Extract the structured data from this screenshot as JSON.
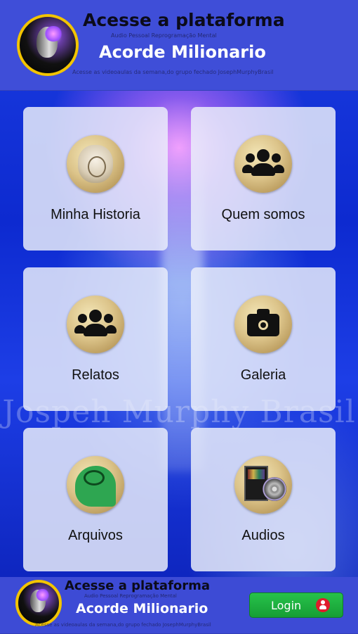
{
  "top_banner": {
    "title": "Acesse a plataforma",
    "subtitle": "Audio Pessoal Reprogramação Mental",
    "main": "Acorde Milionario",
    "footer": "Acesse as videoaulas da semana,do grupo fechado JosephMurphyBrasil"
  },
  "watermark": "Jospeh Murphy Brasil",
  "tiles": [
    {
      "label": "Minha Historia",
      "icon": "portrait-icon"
    },
    {
      "label": "Quem somos",
      "icon": "group-icon"
    },
    {
      "label": "Relatos",
      "icon": "group-icon"
    },
    {
      "label": "Galeria",
      "icon": "camera-icon"
    },
    {
      "label": "Arquivos",
      "icon": "brain-head-icon"
    },
    {
      "label": "Audios",
      "icon": "audio-cd-icon"
    }
  ],
  "bottom_banner": {
    "title": "Acesse a plataforma",
    "subtitle": "Audio Pessoal Reprogramação Mental",
    "main": "Acorde Milionario",
    "footer": "Acesse as videoaulas da semana,do grupo fechado JosephMurphyBrasil",
    "login_label": "Login",
    "login_color": "#1fb13f",
    "login_icon": "user-icon"
  }
}
